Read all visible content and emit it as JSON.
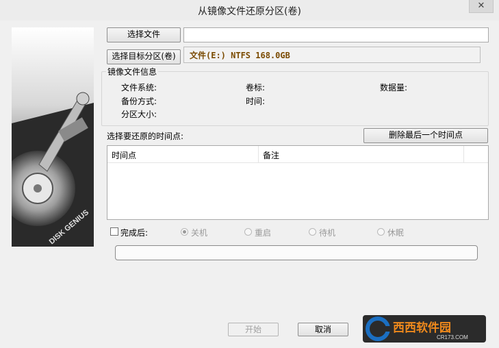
{
  "window": {
    "title": "从镜像文件还原分区(卷)",
    "close_glyph": "✕"
  },
  "side_image": {
    "brand_text": "DISK GENIUS"
  },
  "image_file": {
    "button_label": "选择文件",
    "path_value": ""
  },
  "target": {
    "button_label": "选择目标分区(卷)",
    "value": "文件(E:) NTFS 168.0GB"
  },
  "image_info": {
    "group_title": "镜像文件信息",
    "filesystem_label": "文件系统:",
    "volume_label": "卷标:",
    "data_amount_label": "数据量:",
    "backup_method_label": "备份方式:",
    "time_label": "时间:",
    "partition_size_label": "分区大小:"
  },
  "timepoints": {
    "prompt": "选择要还原的时间点:",
    "delete_button_label": "删除最后一个时间点",
    "columns": [
      "时间点",
      "备注"
    ],
    "rows": []
  },
  "after_completion": {
    "checkbox_label": "完成后:",
    "checked": false,
    "options": [
      {
        "label": "关机",
        "selected": true
      },
      {
        "label": "重启",
        "selected": false
      },
      {
        "label": "待机",
        "selected": false
      },
      {
        "label": "休眠",
        "selected": false
      }
    ]
  },
  "progress": {
    "value": 0
  },
  "footer": {
    "start_label": "开始",
    "cancel_label": "取消"
  },
  "watermark": {
    "text": "西西软件园",
    "subtext": "CR173.COM"
  },
  "colors": {
    "target_text": "#7a4a00",
    "watermark_blue": "#1b6fc2",
    "watermark_orange": "#f08a1c"
  }
}
